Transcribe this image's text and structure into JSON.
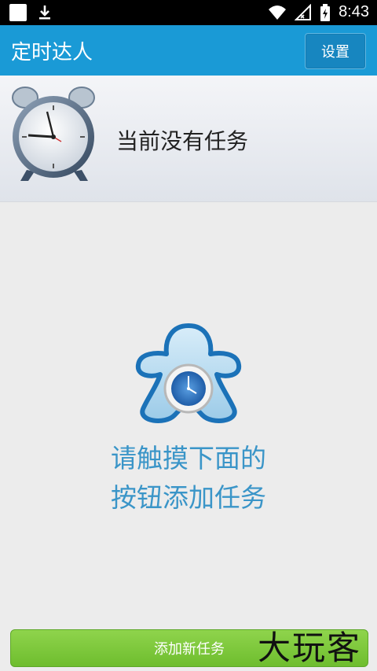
{
  "status_bar": {
    "time": "8:43"
  },
  "app_bar": {
    "title": "定时达人",
    "settings_label": "设置"
  },
  "header": {
    "empty_text": "当前没有任务"
  },
  "hint": {
    "line1": "请触摸下面的",
    "line2": "按钮添加任务"
  },
  "bottom": {
    "add_task_label": "添加新任务"
  },
  "watermark": {
    "text": "大玩客"
  },
  "colors": {
    "accent": "#1a9ad6",
    "button_green": "#7cc63b",
    "hint_blue": "#3a95c8"
  }
}
